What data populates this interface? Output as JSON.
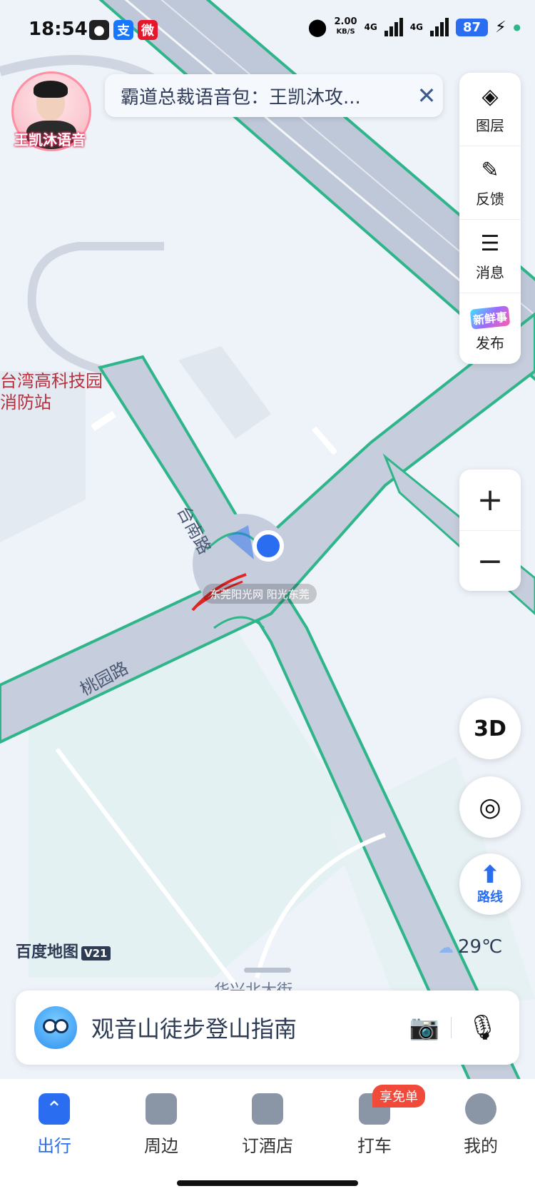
{
  "status_bar": {
    "time": "18:54",
    "net_speed_value": "2.00",
    "net_speed_unit": "KB/S",
    "net_type_1": "4G",
    "net_type_2": "4G",
    "battery": "87",
    "apps": [
      {
        "icon": "wechat-icon",
        "glyph": "●",
        "color": "#222"
      },
      {
        "icon": "alipay-icon",
        "glyph": "支",
        "color": "#1677ff"
      },
      {
        "icon": "weibo-icon",
        "glyph": "微",
        "color": "#e6162d"
      }
    ]
  },
  "voice_pack": {
    "avatar_label": "王凯沐语音",
    "notice_text": "霸道总裁语音包：王凯沐攻...",
    "close_glyph": "✕"
  },
  "side_toolbar": {
    "items": [
      {
        "label": "图层",
        "icon": "layers-icon",
        "glyph": "◈"
      },
      {
        "label": "反馈",
        "icon": "feedback-icon",
        "glyph": "✎"
      },
      {
        "label": "消息",
        "icon": "message-icon",
        "glyph": "☰"
      },
      {
        "label": "发布",
        "icon": "publish-icon",
        "glyph": "新鲜事"
      }
    ]
  },
  "map": {
    "labels": {
      "poi": "台湾高科技园",
      "poi_line2": "消防站",
      "road_1": "台南路",
      "road_2": "桃园路",
      "bottom_road": "华兴北大街"
    },
    "watermark": "东莞阳光网  阳光东莞"
  },
  "zoom": {
    "in": "+",
    "out": "−"
  },
  "controls": {
    "btn_3d": "3D",
    "locate_glyph": "◎",
    "route_glyph": "⬆",
    "route_label": "路线"
  },
  "brand": {
    "logo": "百度地图",
    "version": "V21"
  },
  "weather": {
    "icon": "cloud-icon",
    "glyph": "☁",
    "temp": "29℃"
  },
  "search": {
    "query": "观音山徒步登山指南",
    "camera_glyph": "📷",
    "mic_glyph": "🎙"
  },
  "tabbar": {
    "tabs": [
      {
        "label": "出行",
        "active": true,
        "glyph": "⌃"
      },
      {
        "label": "周边",
        "active": false
      },
      {
        "label": "订酒店",
        "active": false
      },
      {
        "label": "打车",
        "active": false
      },
      {
        "label": "我的",
        "active": false
      }
    ],
    "badge": "享免单"
  }
}
